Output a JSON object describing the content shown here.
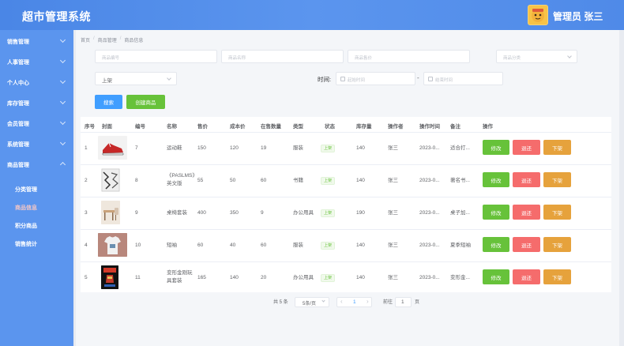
{
  "header": {
    "title": "超市管理系统",
    "user": "管理员 张三",
    "colors": {
      "bar": "#4f8ae8",
      "sidebar": "#5b95ee"
    }
  },
  "sidebar": {
    "items": [
      {
        "label": "销售管理"
      },
      {
        "label": "人事管理"
      },
      {
        "label": "个人中心"
      },
      {
        "label": "库存管理"
      },
      {
        "label": "会员管理"
      },
      {
        "label": "系统管理"
      },
      {
        "label": "商品管理"
      }
    ],
    "sub_items": [
      {
        "label": "分类管理"
      },
      {
        "label": "商品信息"
      },
      {
        "label": "积分商品"
      },
      {
        "label": "销售统计"
      }
    ]
  },
  "breadcrumb": [
    "首页",
    "商品管理",
    "商品信息"
  ],
  "filters": {
    "number_ph": "商品编号",
    "name_ph": "商品名称",
    "price_ph": "商品售价",
    "category_ph": "商品分类",
    "status_value": "上架",
    "time_label": "时间:",
    "start_ph": "起始时间",
    "end_ph": "结束时间",
    "dash": "-",
    "search_btn": "搜索",
    "create_btn": "创建商品"
  },
  "table": {
    "columns": [
      "序号",
      "封面",
      "编号",
      "名称",
      "售价",
      "成本价",
      "在售数量",
      "类型",
      "状态",
      "库存量",
      "操作者",
      "操作时间",
      "备注",
      "操作"
    ],
    "rows": [
      {
        "idx": "1",
        "id": "7",
        "name": "运动鞋",
        "price": "150",
        "cost": "120",
        "qty": "19",
        "type": "服装",
        "status": "上架",
        "stock": "140",
        "operator": "张三",
        "time": "2023-0...",
        "note": "适合打..."
      },
      {
        "idx": "2",
        "id": "8",
        "name": "《PASLMS》英文版",
        "price": "55",
        "cost": "50",
        "qty": "60",
        "type": "书籍",
        "status": "上架",
        "stock": "140",
        "operator": "张三",
        "time": "2023-0...",
        "note": "著名书..."
      },
      {
        "idx": "3",
        "id": "9",
        "name": "桌椅套装",
        "price": "400",
        "cost": "350",
        "qty": "9",
        "type": "办公用具",
        "status": "上架",
        "stock": "190",
        "operator": "张三",
        "time": "2023-0...",
        "note": "桌子加..."
      },
      {
        "idx": "4",
        "id": "10",
        "name": "短袖",
        "price": "60",
        "cost": "40",
        "qty": "60",
        "type": "服装",
        "status": "上架",
        "stock": "140",
        "operator": "张三",
        "time": "2023-0...",
        "note": "夏季短袖"
      },
      {
        "idx": "5",
        "id": "11",
        "name": "变形金刚玩具套装",
        "price": "165",
        "cost": "140",
        "qty": "20",
        "type": "办公用具",
        "status": "上架",
        "stock": "140",
        "operator": "张三",
        "time": "2023-0...",
        "note": "变形金..."
      }
    ],
    "actions": {
      "edit": "修改",
      "return": "退还",
      "off": "下架"
    }
  },
  "pagination": {
    "total": "共 5 条",
    "page_size": "5条/页",
    "prev": "‹",
    "current": "1",
    "next": "›",
    "goto_label": "前往",
    "goto_value": "1",
    "page_unit": "页"
  }
}
